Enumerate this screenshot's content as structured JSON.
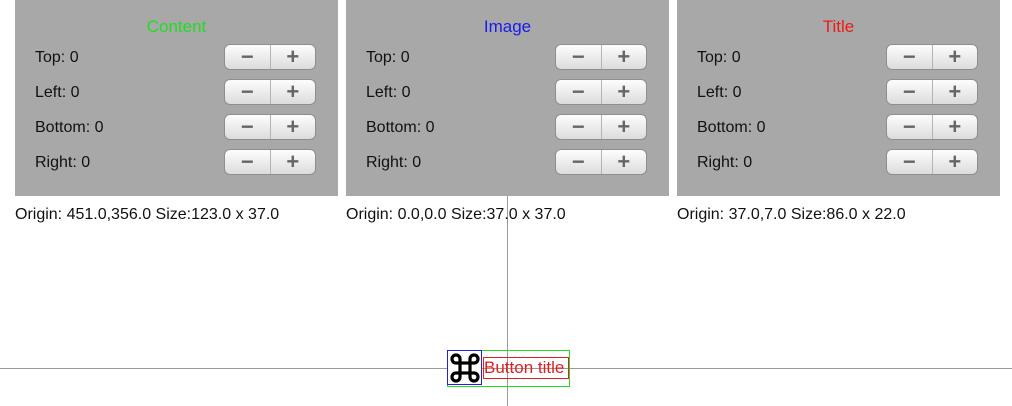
{
  "panels": [
    {
      "title": "Content",
      "title_color": "#22dd22",
      "rows": [
        "Top: 0",
        "Left: 0",
        "Bottom: 0",
        "Right: 0"
      ],
      "origin_text": "Origin: 451.0,356.0 Size:123.0 x 37.0"
    },
    {
      "title": "Image",
      "title_color": "#1a1aee",
      "rows": [
        "Top: 0",
        "Left: 0",
        "Bottom: 0",
        "Right: 0"
      ],
      "origin_text": "Origin: 0.0,0.0 Size:37.0 x 37.0"
    },
    {
      "title": "Title",
      "title_color": "#ee1a1a",
      "rows": [
        "Top: 0",
        "Left: 0",
        "Bottom: 0",
        "Right: 0"
      ],
      "origin_text": "Origin: 37.0,7.0 Size:86.0 x 22.0"
    }
  ],
  "stepper": {
    "minus": "−",
    "plus": "+"
  },
  "button": {
    "title": "Button title",
    "icon": "command-key-icon"
  },
  "colors": {
    "panel_bg": "#a8a8a8",
    "content_outline": "#22dd22",
    "image_outline": "#2222dd",
    "title_outline": "#dd2222"
  }
}
